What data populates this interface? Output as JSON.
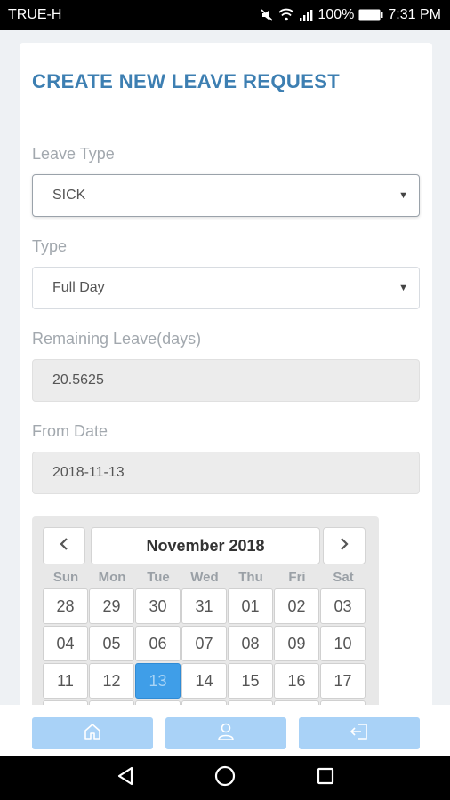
{
  "status_bar": {
    "carrier": "TRUE-H",
    "battery": "100%",
    "time": "7:31 PM",
    "icons": [
      "mute-icon",
      "wifi-icon",
      "signal-icon",
      "battery-icon"
    ]
  },
  "form": {
    "title": "CREATE NEW LEAVE REQUEST",
    "leave_type": {
      "label": "Leave Type",
      "value": "SICK"
    },
    "type": {
      "label": "Type",
      "value": "Full Day"
    },
    "remaining": {
      "label": "Remaining Leave(days)",
      "value": "20.5625"
    },
    "from_date": {
      "label": "From Date",
      "value": "2018-11-13"
    }
  },
  "calendar": {
    "month_label": "November 2018",
    "weekdays": [
      "Sun",
      "Mon",
      "Tue",
      "Wed",
      "Thu",
      "Fri",
      "Sat"
    ],
    "weeks": [
      [
        "28",
        "29",
        "30",
        "31",
        "01",
        "02",
        "03"
      ],
      [
        "04",
        "05",
        "06",
        "07",
        "08",
        "09",
        "10"
      ],
      [
        "11",
        "12",
        "13",
        "14",
        "15",
        "16",
        "17"
      ]
    ],
    "selected_day": "13"
  },
  "bottom_nav": {
    "items": [
      "home-icon",
      "profile-icon",
      "logout-icon"
    ],
    "color": "#a9d2f7"
  },
  "colors": {
    "accent": "#3d7fb2",
    "selected": "#3f9ee8"
  }
}
